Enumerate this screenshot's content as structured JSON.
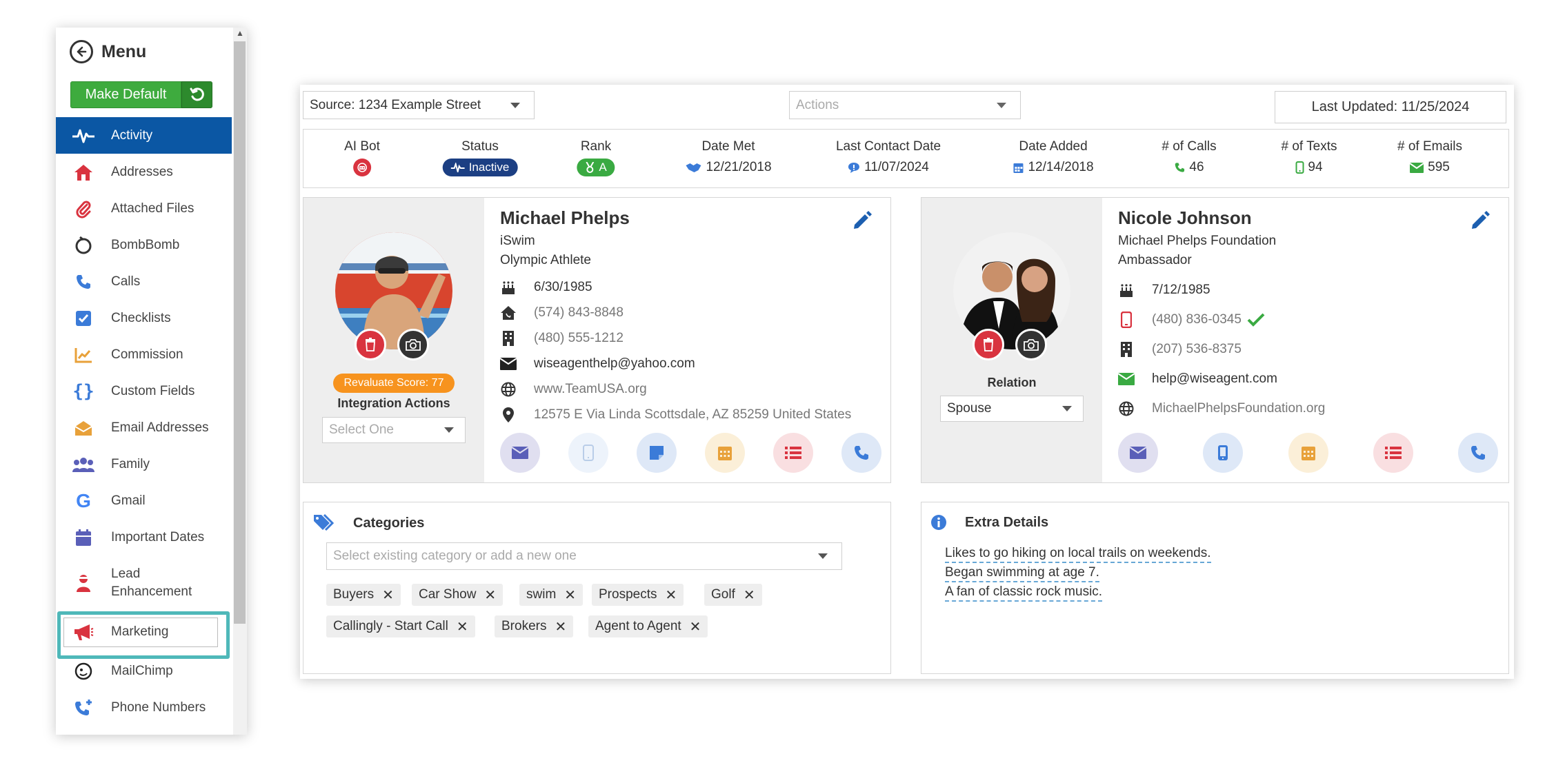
{
  "sidebar": {
    "title": "Menu",
    "make_default_label": "Make Default",
    "items": [
      {
        "label": "Activity",
        "icon": "activity-pulse-icon"
      },
      {
        "label": "Addresses",
        "icon": "house-icon"
      },
      {
        "label": "Attached Files",
        "icon": "paperclip-icon"
      },
      {
        "label": "BombBomb",
        "icon": "bombbomb-icon"
      },
      {
        "label": "Calls",
        "icon": "phone-icon"
      },
      {
        "label": "Checklists",
        "icon": "checkbox-icon"
      },
      {
        "label": "Commission",
        "icon": "chart-icon"
      },
      {
        "label": "Custom Fields",
        "icon": "braces-icon"
      },
      {
        "label": "Email Addresses",
        "icon": "envelope-open-icon"
      },
      {
        "label": "Family",
        "icon": "users-icon"
      },
      {
        "label": "Gmail",
        "icon": "google-icon"
      },
      {
        "label": "Important Dates",
        "icon": "calendar-icon"
      },
      {
        "label": "Lead Enhancement",
        "icon": "user-tie-icon"
      },
      {
        "label": "Marketing",
        "icon": "megaphone-icon"
      },
      {
        "label": "MailChimp",
        "icon": "mailchimp-icon"
      },
      {
        "label": "Phone Numbers",
        "icon": "phone-plus-icon"
      }
    ]
  },
  "toolbar": {
    "source_label": "Source: 1234 Example Street",
    "actions_placeholder": "Actions",
    "last_updated": "Last Updated: 11/25/2024"
  },
  "stats": {
    "ai_bot_label": "AI Bot",
    "status_label": "Status",
    "status_value": "Inactive",
    "rank_label": "Rank",
    "rank_value": "A",
    "date_met_label": "Date Met",
    "date_met_value": "12/21/2018",
    "last_contact_label": "Last Contact Date",
    "last_contact_value": "11/07/2024",
    "date_added_label": "Date Added",
    "date_added_value": "12/14/2018",
    "calls_label": "# of Calls",
    "calls_value": "46",
    "texts_label": "# of Texts",
    "texts_value": "94",
    "emails_label": "# of Emails",
    "emails_value": "595"
  },
  "primary": {
    "name": "Michael Phelps",
    "company": "iSwim",
    "title": "Olympic Athlete",
    "birthday": "6/30/1985",
    "home_phone": "(574) 843-8848",
    "work_phone": "(480) 555-1212",
    "email": "wiseagenthelp@yahoo.com",
    "website": "www.TeamUSA.org",
    "address": "12575 E Via Linda Scottsdale, AZ 85259 United States",
    "score_badge": "Revaluate Score: 77",
    "integration_label": "Integration Actions",
    "integration_placeholder": "Select One"
  },
  "spouse": {
    "name": "Nicole Johnson",
    "company": "Michael Phelps Foundation",
    "title": "Ambassador",
    "birthday": "7/12/1985",
    "mobile_phone": "(480) 836-0345",
    "work_phone": "(207) 536-8375",
    "email": "help@wiseagent.com",
    "website": "MichaelPhelpsFoundation.org",
    "relation_label": "Relation",
    "relation_value": "Spouse"
  },
  "categories": {
    "title": "Categories",
    "placeholder": "Select existing category or add a new one",
    "tags": [
      "Buyers",
      "Car Show",
      "swim",
      "Prospects",
      "Golf",
      "Callingly - Start Call",
      "Brokers",
      "Agent to Agent"
    ]
  },
  "extra": {
    "title": "Extra Details",
    "lines": [
      "Likes to go hiking on local trails on weekends.",
      "Began swimming at age 7.",
      "A fan of classic rock music."
    ]
  },
  "colors": {
    "active_blue": "#0b57a4",
    "green": "#3eab3e",
    "red": "#d9333f",
    "highlight_teal": "#4fb8b9"
  }
}
